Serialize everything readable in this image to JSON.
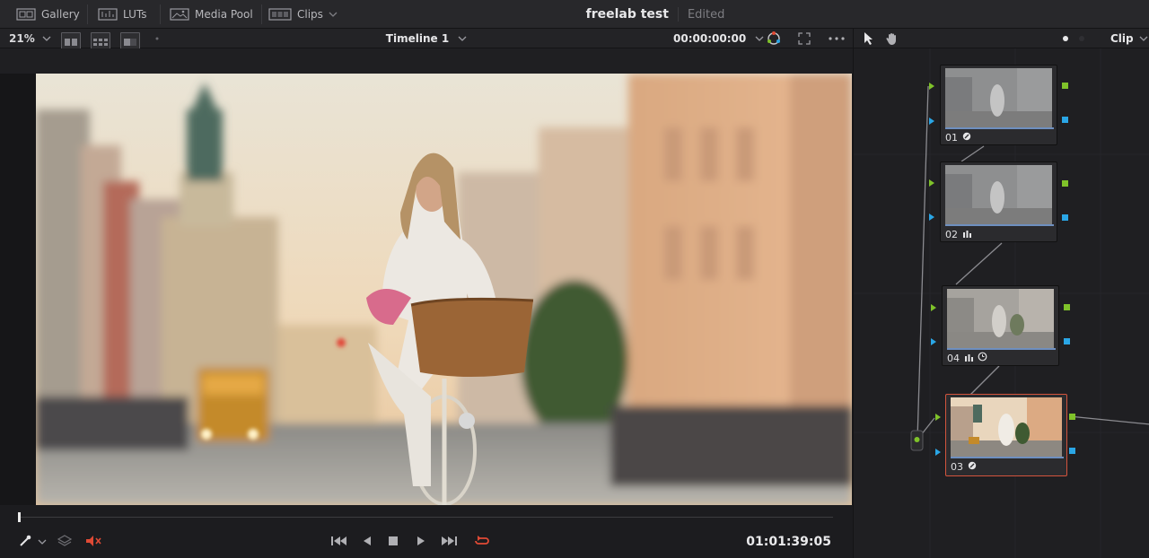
{
  "toolbar": {
    "gallery": "Gallery",
    "luts": "LUTs",
    "media_pool": "Media Pool",
    "clips": "Clips"
  },
  "project": {
    "name": "freelab test",
    "status": "Edited"
  },
  "viewer": {
    "zoom": "21%",
    "timeline_name": "Timeline 1",
    "source_timecode": "00:00:00:00",
    "record_timecode": "01:01:39:05"
  },
  "node_panel": {
    "mode": "Clip"
  },
  "nodes": [
    {
      "label": "01"
    },
    {
      "label": "02"
    },
    {
      "label": "04"
    },
    {
      "label": "03"
    }
  ],
  "colors": {
    "accent_red": "#d3543d",
    "port_green": "#7fc22a",
    "port_blue": "#2aa6e6",
    "loop_red": "#e04a35"
  }
}
